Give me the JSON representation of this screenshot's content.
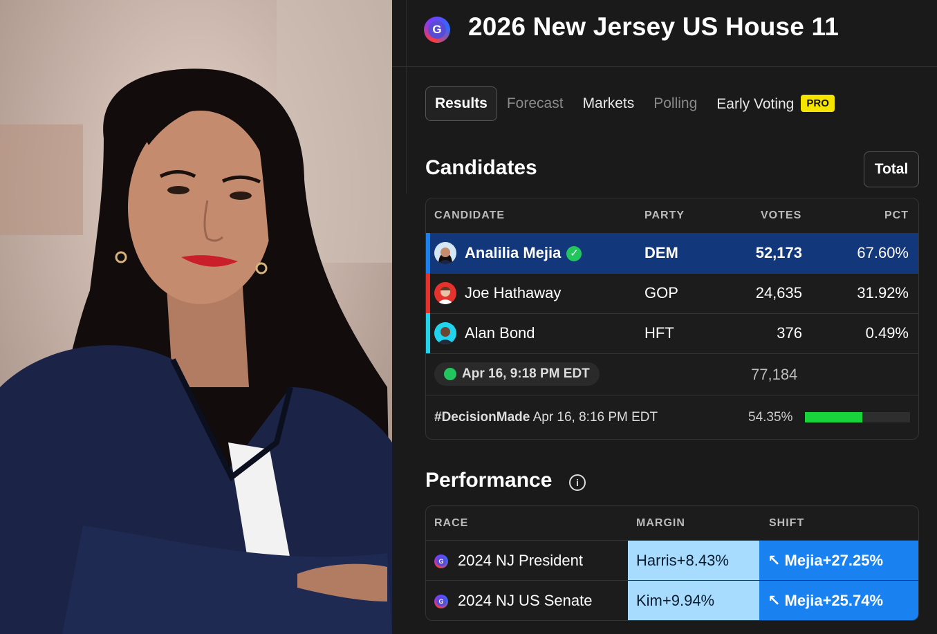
{
  "page": {
    "title": "2026 New Jersey US House 11",
    "logo_letter": "G",
    "photo_alt": "Candidate portrait"
  },
  "tabs": [
    {
      "label": "Results",
      "state": "active"
    },
    {
      "label": "Forecast",
      "state": "dim"
    },
    {
      "label": "Markets",
      "state": "normal"
    },
    {
      "label": "Polling",
      "state": "dim"
    },
    {
      "label": "Early Voting",
      "state": "normal",
      "badge": "PRO"
    }
  ],
  "candidates": {
    "title": "Candidates",
    "total_button": "Total",
    "headers": {
      "candidate": "CANDIDATE",
      "party": "PARTY",
      "votes": "VOTES",
      "pct": "PCT"
    },
    "rows": [
      {
        "name": "Analilia Mejia",
        "party": "DEM",
        "votes": "52,173",
        "pct": "67.60%",
        "winner": true,
        "party_color": "#1a82f0",
        "avatar": "mejia-avatar-icon"
      },
      {
        "name": "Joe Hathaway",
        "party": "GOP",
        "votes": "24,635",
        "pct": "31.92%",
        "winner": false,
        "party_color": "#e5322d",
        "avatar": "hathaway-avatar-icon"
      },
      {
        "name": "Alan Bond",
        "party": "HFT",
        "votes": "376",
        "pct": "0.49%",
        "winner": false,
        "party_color": "#22d3ee",
        "avatar": "bond-avatar-icon"
      }
    ],
    "updated": "Apr 16, 9:18 PM EDT",
    "total_votes": "77,184",
    "decision_tag": "#DecisionMade",
    "decision_time": "Apr 16, 8:16 PM EDT",
    "reporting_pct": "54.35%",
    "reporting_fraction": 0.5435
  },
  "performance": {
    "title": "Performance",
    "headers": {
      "race": "RACE",
      "margin": "MARGIN",
      "shift": "SHIFT"
    },
    "rows": [
      {
        "race": "2024 NJ President",
        "margin": "Harris+8.43%",
        "shift": "↖ Mejia+27.25%"
      },
      {
        "race": "2024 NJ US Senate",
        "margin": "Kim+9.94%",
        "shift": "↖ Mejia+25.74%"
      }
    ]
  },
  "colors": {
    "highlight_row": "#12377a",
    "progress": "#18d43a",
    "margin_cell": "#a8dcff",
    "shift_cell": "#1a82f0",
    "pro_badge": "#f5e400"
  }
}
